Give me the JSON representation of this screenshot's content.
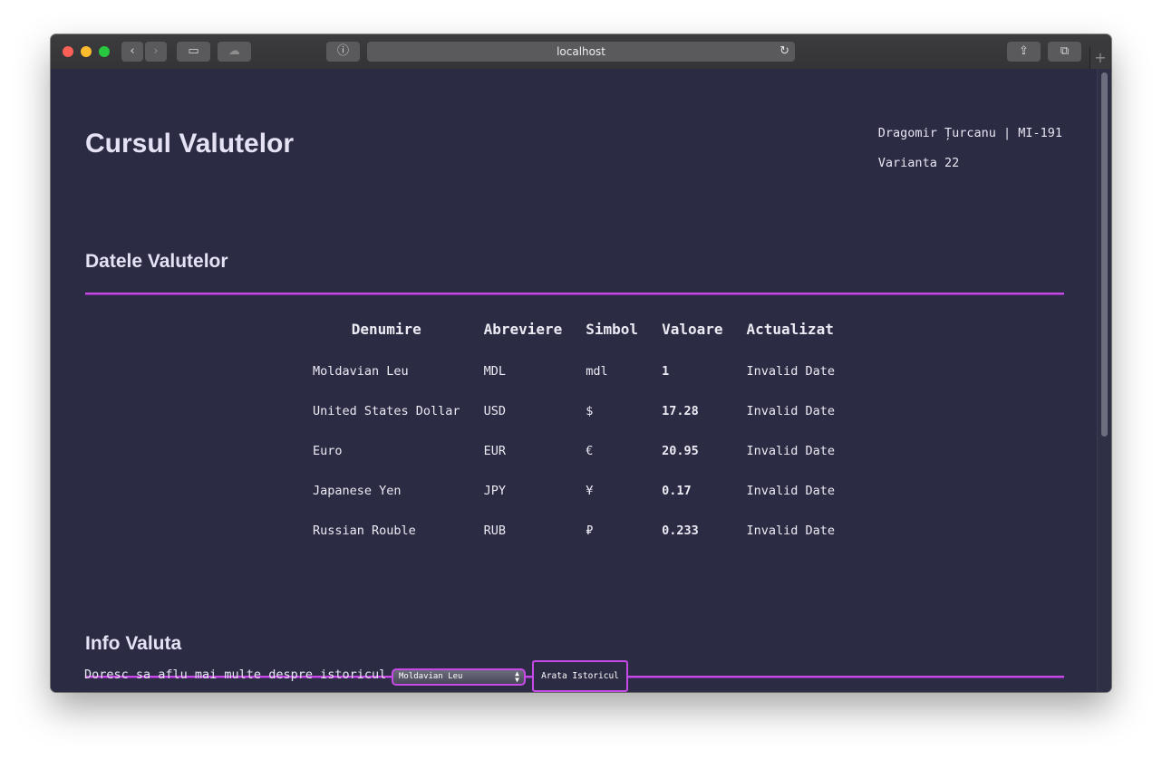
{
  "browser": {
    "address": "localhost",
    "traffic_light_colors": [
      "#fe5f57",
      "#febc2e",
      "#28c840"
    ],
    "back_icon": "‹",
    "forward_icon": "›",
    "sidebar_icon": "▭",
    "cloud_icon": "☁",
    "privacy_icon": "ⓘ",
    "reload_icon": "↻",
    "share_icon": "⇪",
    "tabs_icon": "⧉",
    "new_tab_icon": "+"
  },
  "header": {
    "title": "Cursul Valutelor",
    "author": "Dragomir Țurcanu | MI-191",
    "variant": "Varianta 22"
  },
  "currencies": {
    "heading": "Datele Valutelor",
    "columns": [
      "Denumire",
      "Abreviere",
      "Simbol",
      "Valoare",
      "Actualizat"
    ],
    "rows": [
      {
        "name": "Moldavian Leu",
        "abbr": "MDL",
        "symbol": "mdl",
        "value": "1",
        "updated": "Invalid Date"
      },
      {
        "name": "United States Dollar",
        "abbr": "USD",
        "symbol": "$",
        "value": "17.28",
        "updated": "Invalid Date"
      },
      {
        "name": "Euro",
        "abbr": "EUR",
        "symbol": "€",
        "value": "20.95",
        "updated": "Invalid Date"
      },
      {
        "name": "Japanese Yen",
        "abbr": "JPY",
        "symbol": "¥",
        "value": "0.17",
        "updated": "Invalid Date"
      },
      {
        "name": "Russian Rouble",
        "abbr": "RUB",
        "symbol": "₽",
        "value": "0.233",
        "updated": "Invalid Date"
      }
    ]
  },
  "info": {
    "heading": "Info Valuta",
    "prompt": "Doresc sa aflu mai multe despre istoricul",
    "select_value": "Moldavian Leu",
    "button_label": "Arata Istoricul"
  },
  "colors": {
    "page_bg": "#2b2b44",
    "accent": "#c54ae6",
    "text": "#e8e6f2"
  }
}
